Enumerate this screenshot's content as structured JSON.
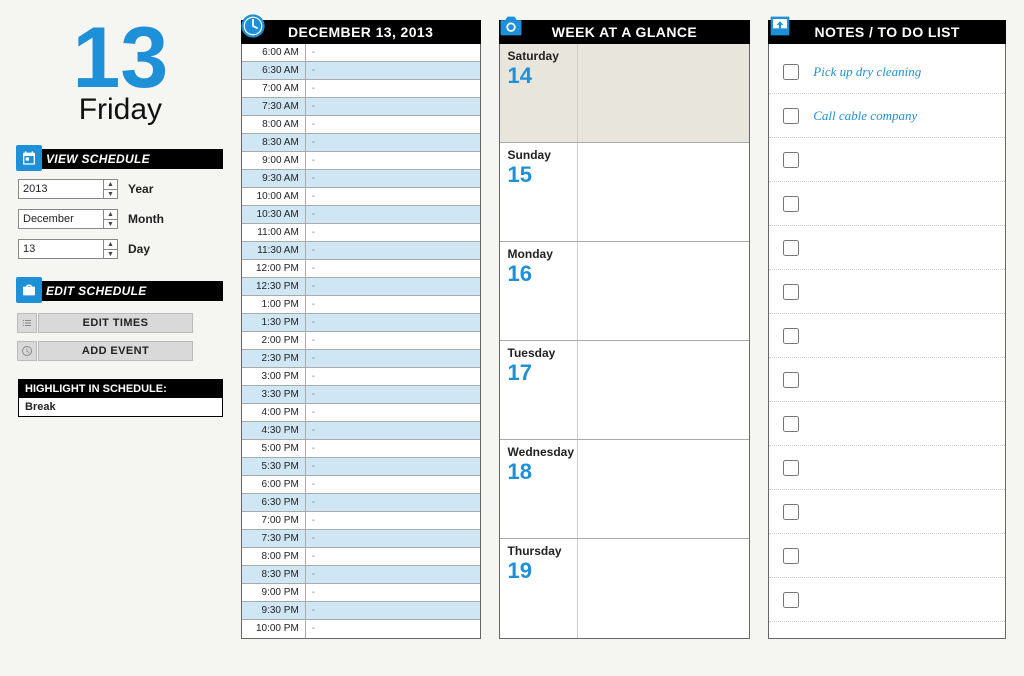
{
  "date": {
    "number": "13",
    "dayName": "Friday",
    "full": "DECEMBER 13, 2013"
  },
  "viewSchedule": {
    "title": "VIEW SCHEDULE",
    "year": "2013",
    "yearLabel": "Year",
    "month": "December",
    "monthLabel": "Month",
    "day": "13",
    "dayLabel": "Day"
  },
  "editSchedule": {
    "title": "EDIT SCHEDULE",
    "editTimes": "EDIT TIMES",
    "addEvent": "ADD EVENT"
  },
  "highlight": {
    "title": "HIGHLIGHT IN SCHEDULE:",
    "value": "Break"
  },
  "schedule": {
    "slots": [
      {
        "time": "6:00 AM",
        "detail": "-",
        "stripe": false
      },
      {
        "time": "6:30 AM",
        "detail": "-",
        "stripe": true
      },
      {
        "time": "7:00 AM",
        "detail": "-",
        "stripe": false
      },
      {
        "time": "7:30 AM",
        "detail": "-",
        "stripe": true
      },
      {
        "time": "8:00 AM",
        "detail": "-",
        "stripe": false
      },
      {
        "time": "8:30 AM",
        "detail": "-",
        "stripe": true
      },
      {
        "time": "9:00 AM",
        "detail": "-",
        "stripe": false
      },
      {
        "time": "9:30 AM",
        "detail": "-",
        "stripe": true
      },
      {
        "time": "10:00 AM",
        "detail": "-",
        "stripe": false
      },
      {
        "time": "10:30 AM",
        "detail": "-",
        "stripe": true
      },
      {
        "time": "11:00 AM",
        "detail": "-",
        "stripe": false
      },
      {
        "time": "11:30 AM",
        "detail": "-",
        "stripe": true
      },
      {
        "time": "12:00 PM",
        "detail": "-",
        "stripe": false
      },
      {
        "time": "12:30 PM",
        "detail": "-",
        "stripe": true
      },
      {
        "time": "1:00 PM",
        "detail": "-",
        "stripe": false
      },
      {
        "time": "1:30 PM",
        "detail": "-",
        "stripe": true
      },
      {
        "time": "2:00 PM",
        "detail": "-",
        "stripe": false
      },
      {
        "time": "2:30 PM",
        "detail": "-",
        "stripe": true
      },
      {
        "time": "3:00 PM",
        "detail": "-",
        "stripe": false
      },
      {
        "time": "3:30 PM",
        "detail": "-",
        "stripe": true
      },
      {
        "time": "4:00 PM",
        "detail": "-",
        "stripe": false
      },
      {
        "time": "4:30 PM",
        "detail": "-",
        "stripe": true
      },
      {
        "time": "5:00 PM",
        "detail": "-",
        "stripe": false
      },
      {
        "time": "5:30 PM",
        "detail": "-",
        "stripe": true
      },
      {
        "time": "6:00 PM",
        "detail": "-",
        "stripe": false
      },
      {
        "time": "6:30 PM",
        "detail": "-",
        "stripe": true
      },
      {
        "time": "7:00 PM",
        "detail": "-",
        "stripe": false
      },
      {
        "time": "7:30 PM",
        "detail": "-",
        "stripe": true
      },
      {
        "time": "8:00 PM",
        "detail": "-",
        "stripe": false
      },
      {
        "time": "8:30 PM",
        "detail": "-",
        "stripe": true
      },
      {
        "time": "9:00 PM",
        "detail": "-",
        "stripe": false
      },
      {
        "time": "9:30 PM",
        "detail": "-",
        "stripe": true
      },
      {
        "time": "10:00 PM",
        "detail": "-",
        "stripe": false
      }
    ]
  },
  "week": {
    "title": "WEEK AT A GLANCE",
    "days": [
      {
        "name": "Saturday",
        "num": "14",
        "first": true
      },
      {
        "name": "Sunday",
        "num": "15",
        "first": false
      },
      {
        "name": "Monday",
        "num": "16",
        "first": false
      },
      {
        "name": "Tuesday",
        "num": "17",
        "first": false
      },
      {
        "name": "Wednesday",
        "num": "18",
        "first": false
      },
      {
        "name": "Thursday",
        "num": "19",
        "first": false
      }
    ]
  },
  "notes": {
    "title": "NOTES / TO DO LIST",
    "items": [
      {
        "text": "Pick up dry cleaning"
      },
      {
        "text": "Call cable company"
      },
      {
        "text": ""
      },
      {
        "text": ""
      },
      {
        "text": ""
      },
      {
        "text": ""
      },
      {
        "text": ""
      },
      {
        "text": ""
      },
      {
        "text": ""
      },
      {
        "text": ""
      },
      {
        "text": ""
      },
      {
        "text": ""
      },
      {
        "text": ""
      }
    ]
  }
}
